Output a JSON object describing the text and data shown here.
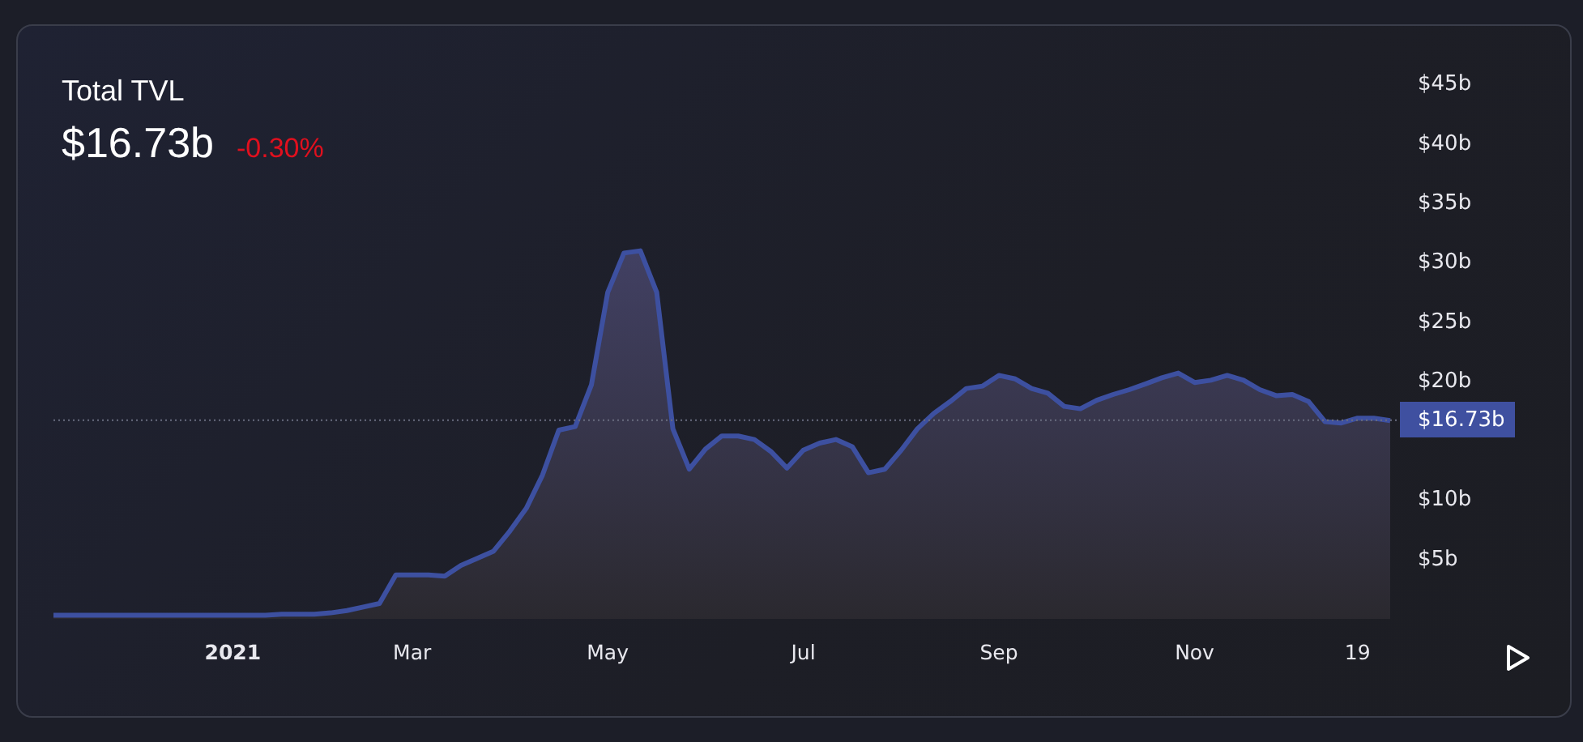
{
  "card": {
    "title": "Total TVL",
    "value": "$16.73b",
    "change": "-0.30%",
    "chart_data": {
      "type": "area",
      "categories": [
        null,
        null,
        null,
        null,
        null,
        null,
        null,
        null,
        null,
        null,
        null,
        "2021",
        null,
        null,
        null,
        null,
        null,
        null,
        null,
        null,
        null,
        null,
        "Mar",
        null,
        null,
        null,
        null,
        null,
        null,
        null,
        null,
        null,
        null,
        null,
        "May",
        null,
        null,
        null,
        null,
        null,
        null,
        null,
        null,
        null,
        null,
        null,
        "Jul",
        null,
        null,
        null,
        null,
        null,
        null,
        null,
        null,
        null,
        null,
        null,
        "Sep",
        null,
        null,
        null,
        null,
        null,
        null,
        null,
        null,
        null,
        null,
        null,
        "Nov",
        null,
        null,
        null,
        null,
        null,
        null,
        null,
        null,
        null,
        "19",
        null,
        null
      ],
      "series": [
        {
          "color": "#3d50a0",
          "values": [
            0.3,
            0.3,
            0.3,
            0.3,
            0.3,
            0.3,
            0.3,
            0.3,
            0.3,
            0.3,
            0.3,
            0.3,
            0.3,
            0.3,
            0.4,
            0.4,
            0.4,
            0.5,
            0.7,
            1.0,
            1.3,
            3.7,
            3.7,
            3.7,
            3.6,
            4.5,
            5.1,
            5.7,
            7.4,
            9.3,
            12.1,
            15.9,
            16.2,
            19.7,
            27.5,
            30.8,
            31.0,
            27.5,
            16.0,
            12.6,
            14.3,
            15.4,
            15.4,
            15.1,
            14.1,
            12.7,
            14.2,
            14.8,
            15.1,
            14.5,
            12.3,
            12.6,
            14.2,
            16.0,
            17.3,
            18.3,
            19.4,
            19.6,
            20.5,
            20.2,
            19.4,
            19.0,
            17.9,
            17.7,
            18.4,
            18.9,
            19.3,
            19.8,
            20.3,
            20.7,
            19.9,
            20.1,
            20.5,
            20.1,
            19.3,
            18.8,
            18.9,
            18.3,
            16.6,
            16.5,
            16.9,
            16.9,
            16.7
          ]
        }
      ],
      "ylim": [
        0,
        45
      ],
      "ref_lines": [
        {
          "axis": "y",
          "value": 16.73,
          "label": "$16.73b"
        }
      ],
      "yticks": [
        {
          "value": 5,
          "label": "$5b"
        },
        {
          "value": 10,
          "label": "$10b"
        },
        {
          "value": 20,
          "label": "$20b"
        },
        {
          "value": 25,
          "label": "$25b"
        },
        {
          "value": 30,
          "label": "$30b"
        },
        {
          "value": 35,
          "label": "$35b"
        },
        {
          "value": 40,
          "label": "$40b"
        },
        {
          "value": 45,
          "label": "$45b"
        }
      ]
    }
  }
}
